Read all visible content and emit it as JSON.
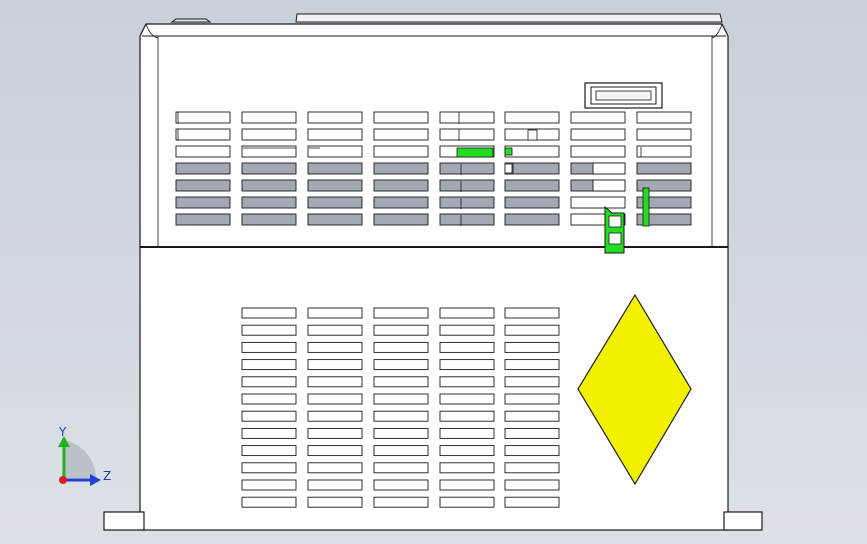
{
  "triad": {
    "y_label": "Y",
    "z_label": "Z",
    "y_color": "#1ab31a",
    "z_color": "#1f3fd6",
    "origin_color": "#d62020"
  },
  "colors": {
    "background_top": "#c9d0da",
    "body_fill": "#ffffff",
    "outline": "#1a1a1a",
    "vent_shaded": "#a3a8b2",
    "highlight_green": "#22dd22",
    "warning_yellow": "#f2f200"
  }
}
